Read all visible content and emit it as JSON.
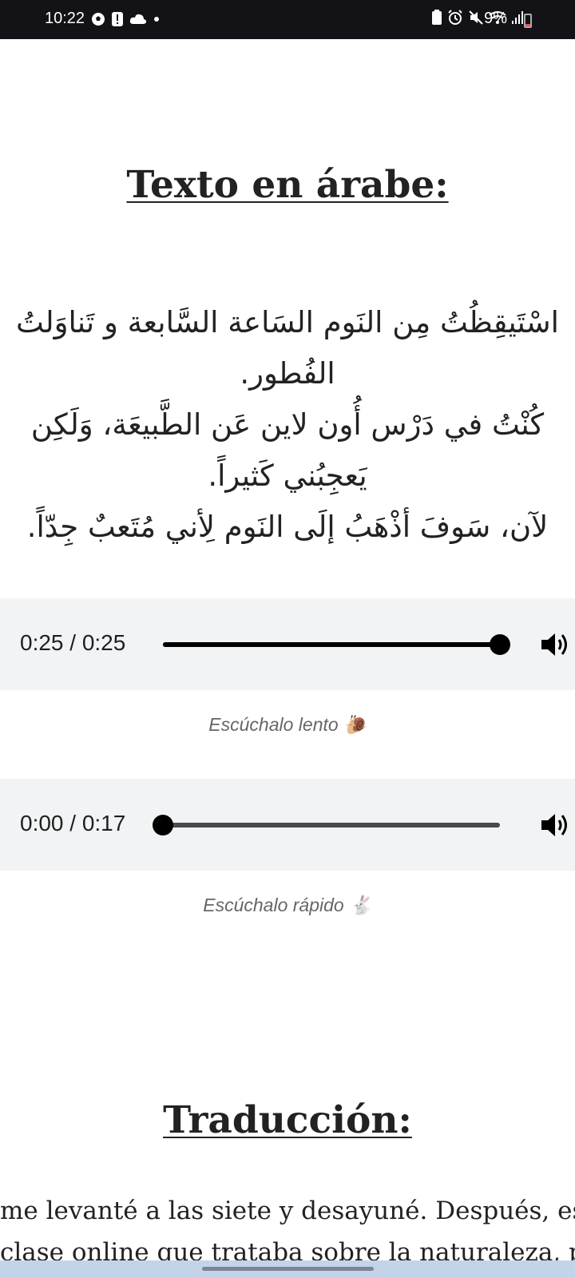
{
  "status_bar": {
    "time": "10:22",
    "battery": "9%"
  },
  "headings": {
    "arabic": "Texto en árabe:",
    "translation": "Traducción:"
  },
  "arabic_text": {
    "lines": [
      "اسْتَيقِظُتُ مِن النَوم السَاعة السَّابعة و تَناوَلتُ",
      "الفُطور.",
      "كُنْتُ في دَرْس أُون لاين عَن الطَّبيعَة، وَلَكِن",
      "يَعجِبُني كَثيراً.",
      "لآن، سَوفَ أذْهَبُ إلَى النَوم لِأني مُتَعبٌ جِدّاً."
    ]
  },
  "players": [
    {
      "time": "0:25 / 0:25",
      "progress": 1.0,
      "caption": "Escúchalo lento 🐌"
    },
    {
      "time": "0:00 / 0:17",
      "progress": 0.0,
      "caption": "Escúchalo rápido 🐇"
    }
  ],
  "translation_text": {
    "lines": [
      "me levanté a las siete y desayuné. Después, estu",
      "clase online que trataba sobre la naturaleza, pe"
    ]
  }
}
